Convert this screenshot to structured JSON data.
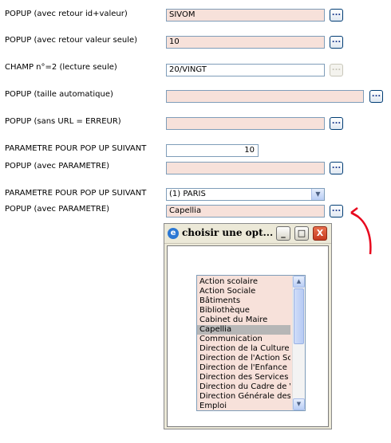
{
  "rows": [
    {
      "label": "POPUP (avec retour id+valeur)",
      "value": "SIVOM",
      "button": "..."
    },
    {
      "label": "POPUP (avec retour valeur seule)",
      "value": "10",
      "button": "..."
    },
    {
      "label": "CHAMP n°=2 (lecture seule)",
      "value": "20/VINGT",
      "button": "..."
    },
    {
      "label": "POPUP (taille automatique)",
      "value": "",
      "button": "..."
    },
    {
      "label": "POPUP (sans URL = ERREUR)",
      "value": "",
      "button": "..."
    },
    {
      "label": "PARAMETRE POUR POP UP SUIVANT",
      "value": "10"
    },
    {
      "label": "POPUP (avec PARAMETRE)",
      "value": "",
      "button": "..."
    },
    {
      "label": "PARAMETRE POUR POP UP SUIVANT",
      "value": "(1) PARIS"
    },
    {
      "label": "POPUP (avec PARAMETRE)",
      "value": "Capellia",
      "button": "..."
    }
  ],
  "popup": {
    "title": "choisir une opt...",
    "buttons": {
      "minimize": "_",
      "maximize": "□",
      "close": "X"
    },
    "list": {
      "items": [
        "Action scolaire",
        "Action Sociale",
        "Bâtiments",
        "Bibliothèque",
        "Cabinet du Maire",
        "Capellia",
        "Communication",
        "Direction de la Culture",
        "Direction de l'Action Sociale",
        "Direction de l'Enfance",
        "Direction des Services",
        "Direction du Cadre de Vie",
        "Direction Générale des Services",
        "Emploi"
      ],
      "selected": "Capellia"
    }
  },
  "icons": {
    "dropdown": "chevron-down-icon",
    "popup": "ie-icon",
    "annotation": "red-arrow-icon"
  },
  "colors": {
    "field_bg": "#f7e1da",
    "selected_item": "#b6b6b6",
    "arrow": "#e8081e"
  }
}
